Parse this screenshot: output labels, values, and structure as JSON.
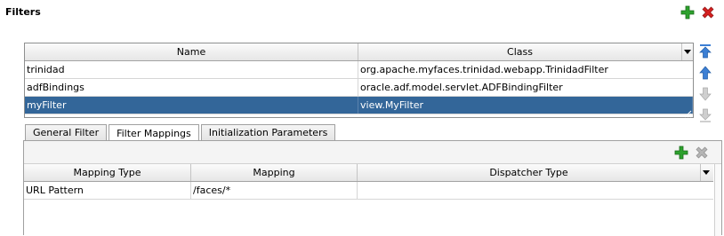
{
  "header": {
    "title": "Filters"
  },
  "filters_table": {
    "columns": [
      "Name",
      "Class"
    ],
    "rows": [
      {
        "name": "trinidad",
        "class": "org.apache.myfaces.trinidad.webapp.TrinidadFilter",
        "selected": false
      },
      {
        "name": "adfBindings",
        "class": "oracle.adf.model.servlet.ADFBindingFilter",
        "selected": false
      },
      {
        "name": "myFilter",
        "class": "view.MyFilter",
        "selected": true
      }
    ]
  },
  "tabs": [
    {
      "label": "General Filter",
      "active": false
    },
    {
      "label": "Filter Mappings",
      "active": true
    },
    {
      "label": "Initialization Parameters",
      "active": false
    }
  ],
  "mappings_table": {
    "columns": [
      "Mapping Type",
      "Mapping",
      "Dispatcher Type"
    ],
    "rows": [
      {
        "type": "URL Pattern",
        "mapping": "/faces/*",
        "dispatcher": ""
      }
    ]
  },
  "colors": {
    "selection": "#336699",
    "add_green": "#2da12d",
    "delete_red": "#d42020",
    "arrow_blue": "#3c7fd4",
    "disabled_gray": "#b5b5b5"
  },
  "icons": {
    "add": "plus-icon",
    "delete": "close-icon",
    "move_top": "double-up-arrow-icon",
    "move_up": "up-arrow-icon",
    "move_down": "down-arrow-icon",
    "move_bottom": "double-down-arrow-icon"
  }
}
